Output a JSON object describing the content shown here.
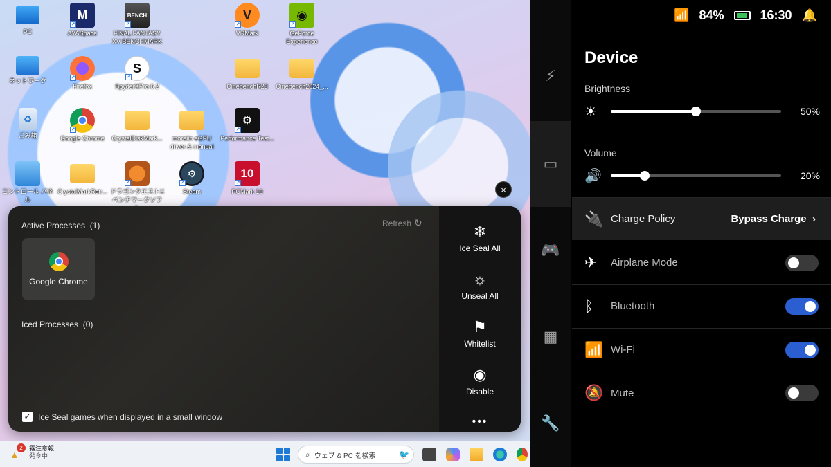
{
  "desktop": {
    "icons": [
      {
        "label": "PC",
        "icon": "monitor-icon"
      },
      {
        "label": "AYASpace",
        "icon": "ayaspace-icon"
      },
      {
        "label": "FINAL FANTASY XV BENCHMARK",
        "icon": "ffxv-icon"
      },
      {
        "label": "VRMark",
        "icon": "vrmark-icon"
      },
      {
        "label": "GeForce Experience",
        "icon": "geforce-icon"
      },
      {
        "label": "ネットワーク",
        "icon": "network-icon"
      },
      {
        "label": "Firefox",
        "icon": "firefox-icon"
      },
      {
        "label": "SpyderXPro 6.2",
        "icon": "spyder-icon"
      },
      {
        "label": "CinebenchR23",
        "icon": "folder-icon"
      },
      {
        "label": "Cinebench2024_...",
        "icon": "folder-icon"
      },
      {
        "label": "ごみ箱",
        "icon": "recycle-bin-icon"
      },
      {
        "label": "Google Chrome",
        "icon": "chrome-icon"
      },
      {
        "label": "CrystalDiskMark...",
        "icon": "folder-icon"
      },
      {
        "label": "moreiin eGPU driver & manual",
        "icon": "folder-icon"
      },
      {
        "label": "Performance Test...",
        "icon": "performance-test-icon"
      },
      {
        "label": "コントロール パネル",
        "icon": "control-panel-icon"
      },
      {
        "label": "CrystalMarkRetr...",
        "icon": "folder-icon"
      },
      {
        "label": "ドラゴンクエストX ベンチマークソフト",
        "icon": "dqx-icon"
      },
      {
        "label": "Steam",
        "icon": "steam-icon"
      },
      {
        "label": "PCMark 10",
        "icon": "pcmark-icon"
      }
    ]
  },
  "taskbar": {
    "weather_title": "霧注意報",
    "weather_sub": "発令中",
    "weather_badge": "2",
    "search_placeholder": "ウェブ & PC を検索"
  },
  "panel": {
    "active_label": "Active Processes",
    "active_count": "(1)",
    "refresh_label": "Refresh",
    "process_name": "Google Chrome",
    "iced_label": "Iced Processes",
    "iced_count": "(0)",
    "checkbox_label": "Ice Seal games when displayed in a small window",
    "checkbox_checked": true,
    "actions": [
      {
        "label": "Ice Seal All",
        "glyph": "❄",
        "icon": "snowflake-icon"
      },
      {
        "label": "Unseal All",
        "glyph": "☼",
        "icon": "sun-icon"
      },
      {
        "label": "Whitelist",
        "glyph": "⚑",
        "icon": "flag-icon"
      },
      {
        "label": "Disable",
        "glyph": "◉",
        "icon": "stop-circle-icon"
      }
    ],
    "more_glyph": "•••",
    "close_glyph": "×"
  },
  "status": {
    "battery": "84%",
    "time": "16:30"
  },
  "device": {
    "title": "Device",
    "brightness_label": "Brightness",
    "brightness_value": "50%",
    "brightness_level": 0.5,
    "volume_label": "Volume",
    "volume_value": "20%",
    "volume_level": 0.2
  },
  "quick": {
    "charge_label": "Charge Policy",
    "charge_value": "Bypass Charge",
    "airplane_label": "Airplane Mode",
    "airplane_on": false,
    "bluetooth_label": "Bluetooth",
    "bluetooth_on": true,
    "wifi_label": "Wi-Fi",
    "wifi_on": true,
    "mute_label": "Mute",
    "mute_on": false
  },
  "colors": {
    "toggle_on": "#2b5fd1",
    "toggle_off": "#3a3a3a",
    "panel_bg": "#000000"
  }
}
